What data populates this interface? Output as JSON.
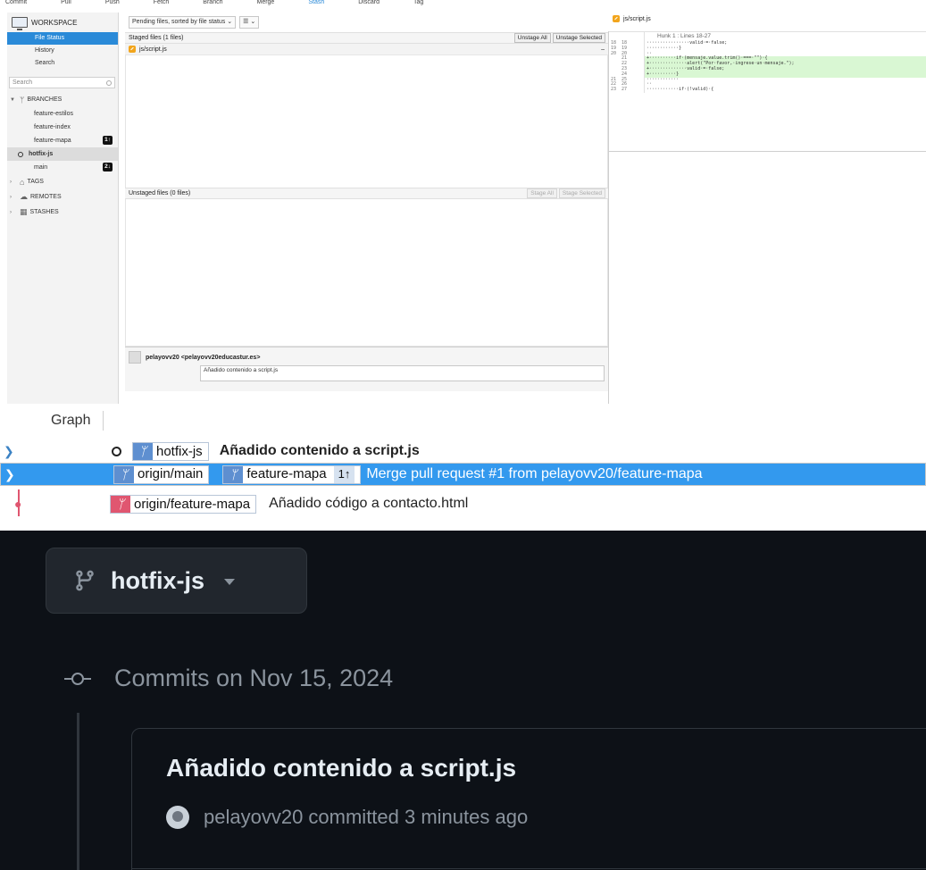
{
  "toolbar": {
    "items": [
      "Commit",
      "Pull",
      "Push",
      "Fetch",
      "Branch",
      "Merge",
      "Stash",
      "Discard",
      "Tag"
    ]
  },
  "sidebar": {
    "workspace_label": "WORKSPACE",
    "workspace_items": [
      "File Status",
      "History",
      "Search"
    ],
    "search_placeholder": "Search",
    "groups": {
      "branches": "BRANCHES",
      "tags": "TAGS",
      "remotes": "REMOTES",
      "stashes": "STASHES"
    },
    "branches": [
      {
        "name": "feature-estilos",
        "badge": ""
      },
      {
        "name": "feature-index",
        "badge": ""
      },
      {
        "name": "feature-mapa",
        "badge": "1↑"
      },
      {
        "name": "hotfix-js",
        "badge": ""
      },
      {
        "name": "main",
        "badge": "2↓"
      }
    ]
  },
  "file_status": {
    "filter_label": "Pending files, sorted by file status",
    "view_toggle": "☰",
    "staged_header": "Staged files  (1 files)",
    "unstage_all": "Unstage All",
    "unstage_selected": "Unstage Selected",
    "staged_file": "js/script.js",
    "collapse": "–",
    "unstaged_header": "Unstaged files  (0 files)",
    "stage_all": "Stage All",
    "stage_selected": "Stage Selected"
  },
  "commit_panel": {
    "author": "pelayovv20 <pelayovv20educastur.es>",
    "message": "Añadido contenido a script.js"
  },
  "diff": {
    "file": "js/script.js",
    "hunk_label": "Hunk 1 : Lines 18-27",
    "lines": [
      {
        "old": "18",
        "new": "18",
        "type": "ctx",
        "code": "················valid·=·false;"
      },
      {
        "old": "19",
        "new": "19",
        "type": "ctx",
        "code": "············}"
      },
      {
        "old": "20",
        "new": "20",
        "type": "ctx",
        "code": "··"
      },
      {
        "old": "",
        "new": "21",
        "type": "add",
        "code": "+··········if·(mensaje.value.trim()·===·\"\")·{"
      },
      {
        "old": "",
        "new": "22",
        "type": "add",
        "code": "+··············alert(\"Por·favor,·ingrese·un·mensaje.\");"
      },
      {
        "old": "",
        "new": "23",
        "type": "add",
        "code": "+··············valid·=·false;"
      },
      {
        "old": "",
        "new": "24",
        "type": "add",
        "code": "+··········}"
      },
      {
        "old": "21",
        "new": "25",
        "type": "ctx",
        "code": "············"
      },
      {
        "old": "22",
        "new": "26",
        "type": "ctx",
        "code": "··"
      },
      {
        "old": "23",
        "new": "27",
        "type": "ctx",
        "code": "············if·(!valid)·{"
      }
    ]
  },
  "graph": {
    "tab": "Graph",
    "rows": [
      {
        "refs": [
          {
            "name": "hotfix-js",
            "color": "blue",
            "count": ""
          }
        ],
        "message": "Añadido contenido a script.js",
        "head": true
      },
      {
        "refs": [
          {
            "name": "origin/main",
            "color": "blue",
            "count": ""
          },
          {
            "name": "feature-mapa",
            "color": "blue",
            "count": "1↑"
          }
        ],
        "message": "Merge pull request #1 from pelayovv20/feature-mapa",
        "head": false
      },
      {
        "refs": [
          {
            "name": "origin/feature-mapa",
            "color": "red",
            "count": ""
          }
        ],
        "message": "Añadido código a contacto.html",
        "head": false
      }
    ]
  },
  "github": {
    "branch": "hotfix-js",
    "commits_date": "Commits on Nov 15, 2024",
    "commit_title": "Añadido contenido a script.js",
    "commit_meta": "pelayovv20 committed 3 minutes ago"
  },
  "colors": {
    "selection": "#2a8ad8",
    "graph_selection": "#3399ee",
    "ref_blue": "#5e8fd0",
    "ref_red": "#e05670",
    "diff_add": "#d9f7d3",
    "gh_bg": "#0d1117"
  }
}
